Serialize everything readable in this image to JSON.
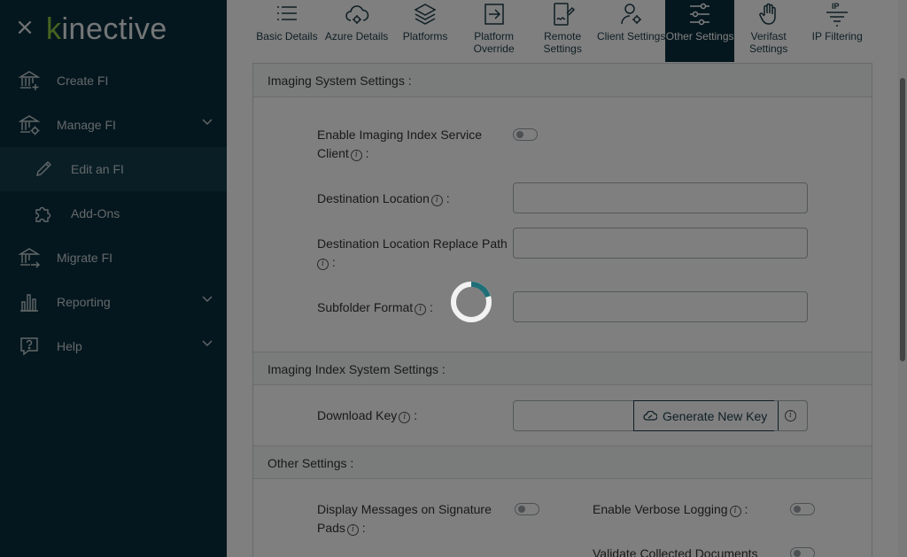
{
  "sidebar": {
    "logo": "kinective",
    "items": [
      {
        "label": "Create FI",
        "icon": "bank-plus-icon"
      },
      {
        "label": "Manage FI",
        "icon": "bank-gear-icon"
      },
      {
        "label": "Edit an FI",
        "icon": "pencil-icon"
      },
      {
        "label": "Add-Ons",
        "icon": "puzzle-icon"
      },
      {
        "label": "Migrate FI",
        "icon": "bank-arrow-icon"
      },
      {
        "label": "Reporting",
        "icon": "bar-chart-icon"
      },
      {
        "label": "Help",
        "icon": "question-bubble-icon"
      }
    ]
  },
  "tabs": [
    {
      "label": "Basic Details",
      "icon": "list-icon"
    },
    {
      "label": "Azure Details",
      "icon": "cloud-gear-icon"
    },
    {
      "label": "Platforms",
      "icon": "layers-icon"
    },
    {
      "label": "Platform Override",
      "icon": "arrow-into-box-icon"
    },
    {
      "label": "Remote Settings",
      "icon": "remote-sign-icon"
    },
    {
      "label": "Client Settings",
      "icon": "user-gear-icon"
    },
    {
      "label": "Other Settings",
      "icon": "sliders-icon",
      "active": true
    },
    {
      "label": "Verifast Settings",
      "icon": "hand-icon"
    },
    {
      "label": "IP Filtering",
      "icon": "ip-filter-icon"
    }
  ],
  "sections": {
    "imaging": "Imaging System Settings :",
    "imaging_index": "Imaging Index System Settings :",
    "other": "Other Settings :"
  },
  "fields": {
    "enable_imaging_index": "Enable Imaging Index Service Client",
    "destination_location": "Destination Location",
    "destination_replace": "Destination Location Replace Path",
    "subfolder_format": "Subfolder Format",
    "download_key": "Download Key",
    "display_messages": "Display Messages on Signature Pads",
    "enable_verbose": "Enable Verbose Logging",
    "validate_collected": "Validate Collected Documents"
  },
  "buttons": {
    "generate_key": "Generate New Key"
  },
  "colors": {
    "sidebar_bg": "#0b2f3c",
    "accent": "#8fc640",
    "spinner": "#1f6f78"
  }
}
